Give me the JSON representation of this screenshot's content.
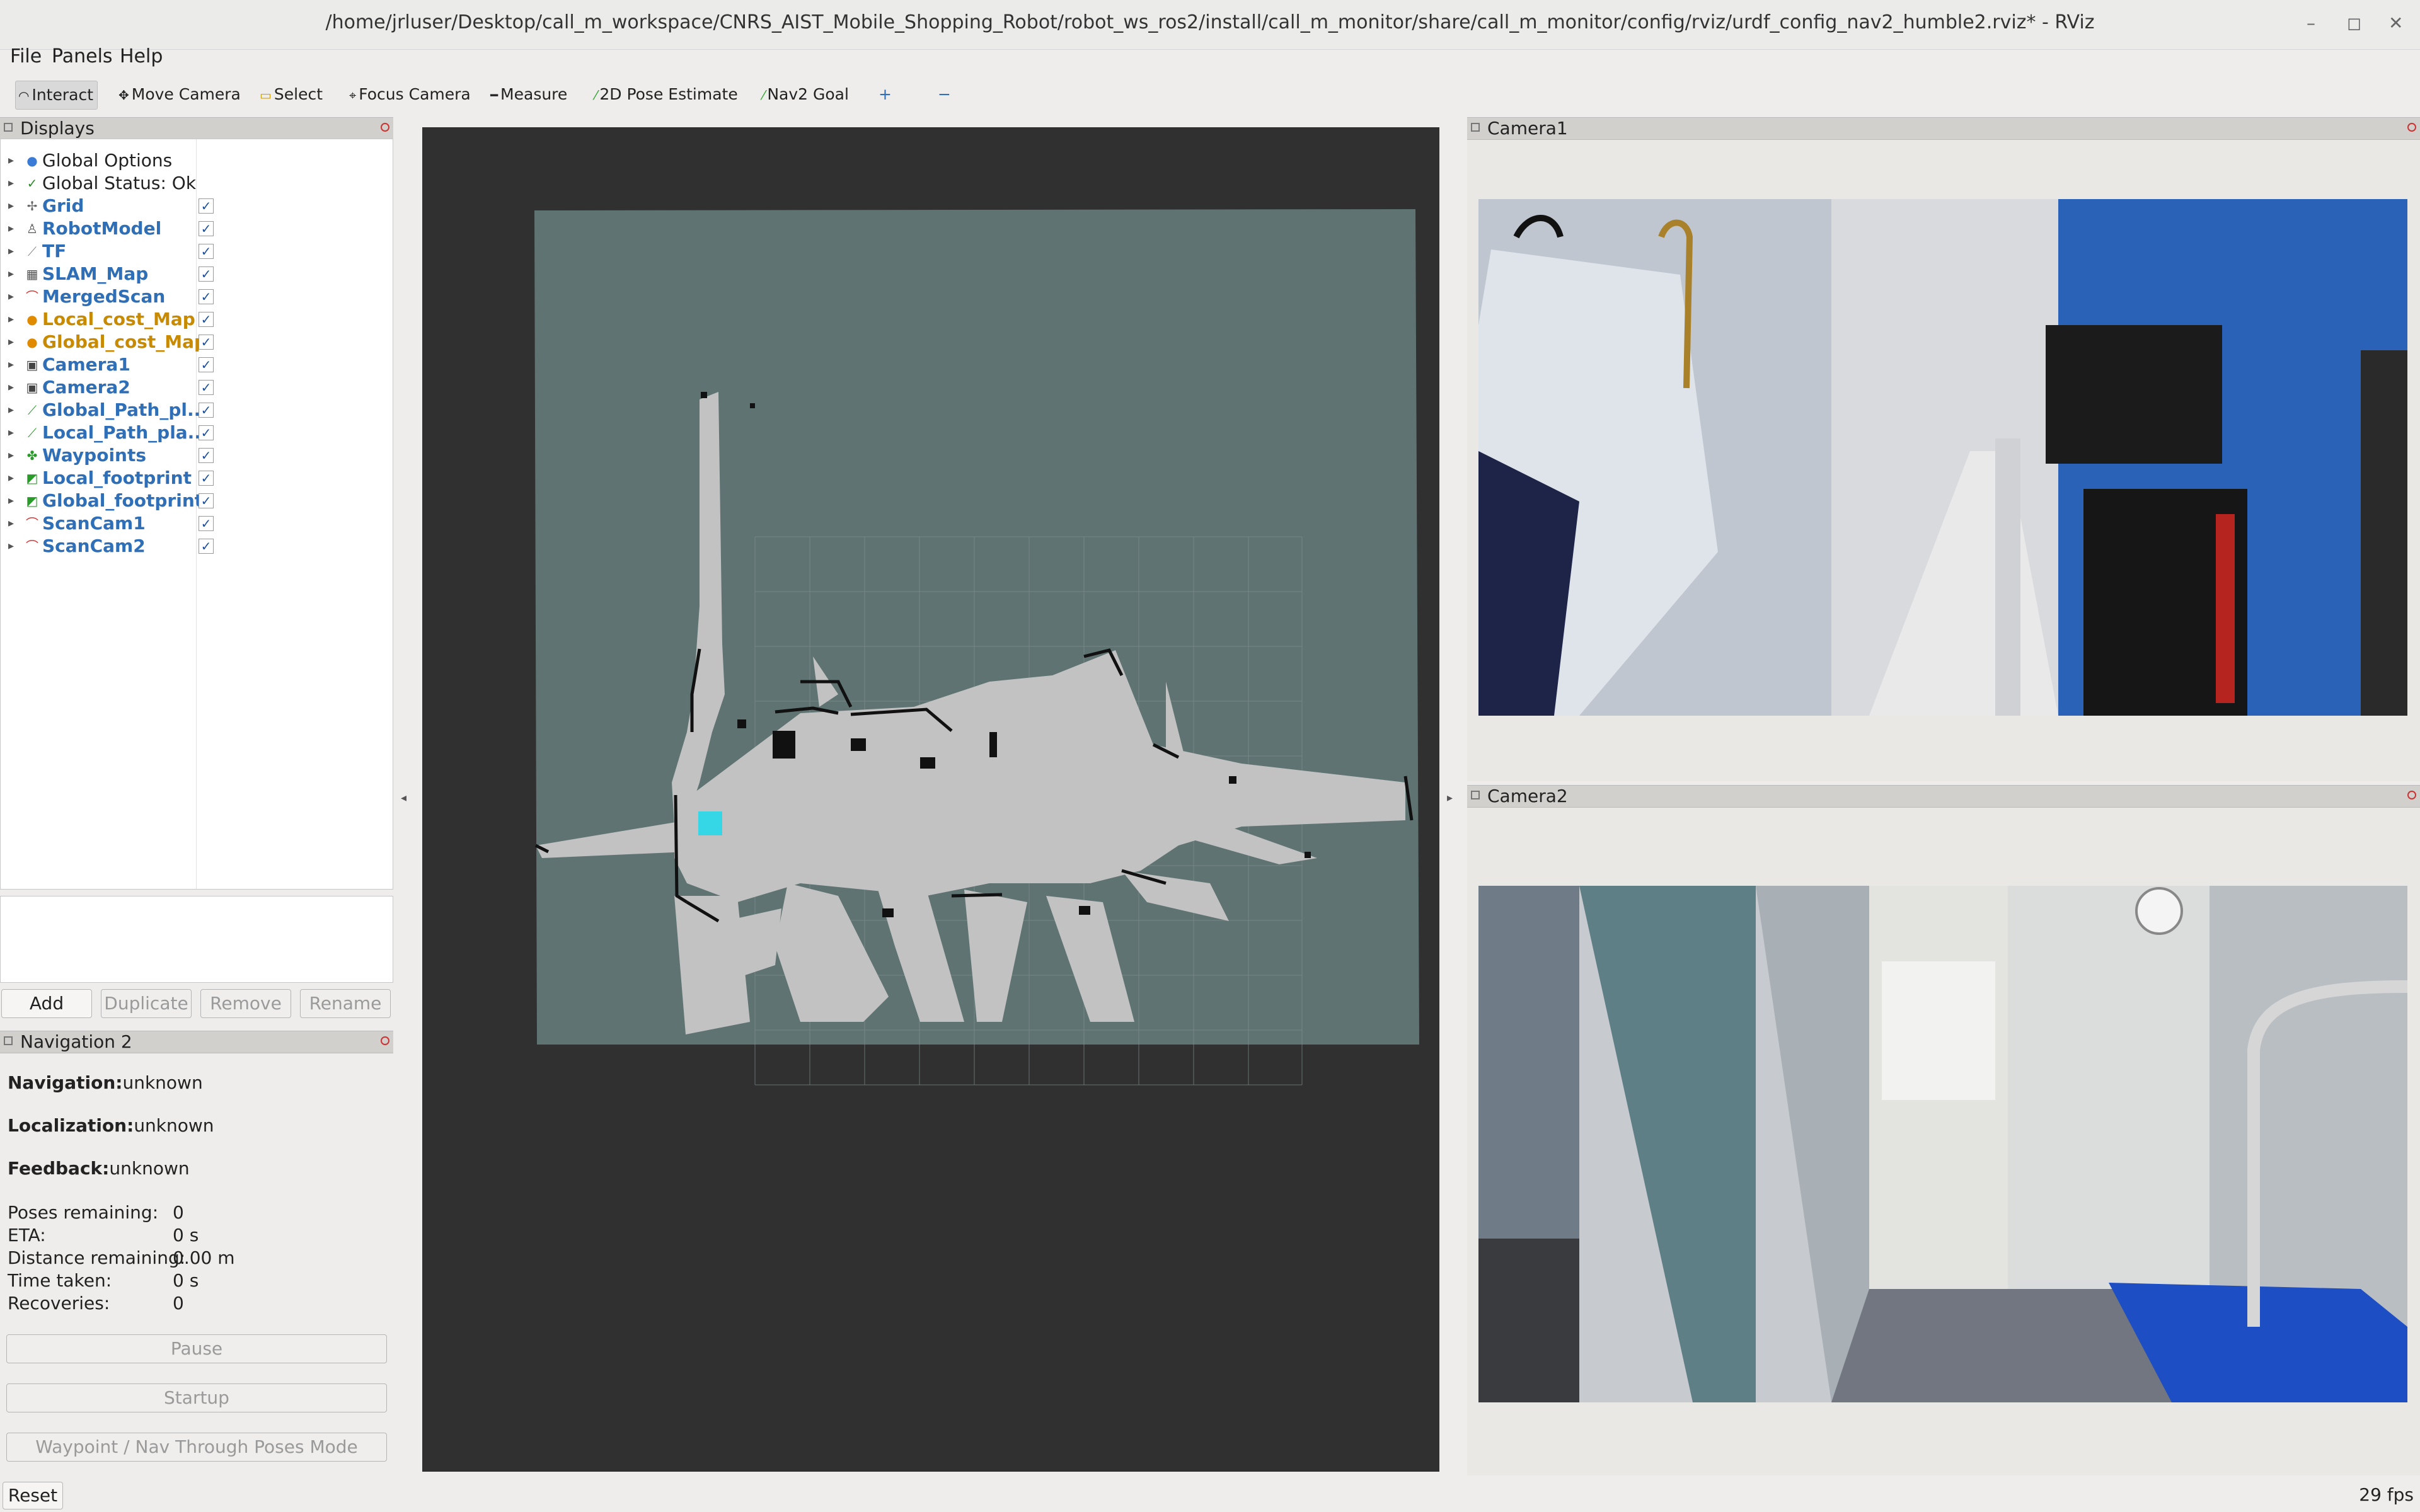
{
  "window": {
    "title": "/home/jrluser/Desktop/call_m_workspace/CNRS_AIST_Mobile_Shopping_Robot/robot_ws_ros2/install/call_m_monitor/share/call_m_monitor/config/rviz/urdf_config_nav2_humble2.rviz* - RViz",
    "minimize": "–",
    "maximize": "◻",
    "close": "✕"
  },
  "menu": {
    "file": "File",
    "panels": "Panels",
    "help": "Help"
  },
  "toolbar": {
    "interact": "Interact",
    "move_camera": "Move Camera",
    "select": "Select",
    "focus_camera": "Focus Camera",
    "measure": "Measure",
    "pose_estimate": "2D Pose Estimate",
    "nav2_goal": "Nav2 Goal",
    "plus": "+",
    "minus": "−"
  },
  "displays": {
    "title": "Displays",
    "items": [
      {
        "label": "Global Options",
        "icon": "gear-icon",
        "style": "plain",
        "checked": null
      },
      {
        "label": "Global Status: Ok",
        "icon": "check-icon",
        "style": "plain",
        "checked": null
      },
      {
        "label": "Grid",
        "icon": "grid-icon",
        "style": "blue",
        "checked": true
      },
      {
        "label": "RobotModel",
        "icon": "robot-icon",
        "style": "blue",
        "checked": true
      },
      {
        "label": "TF",
        "icon": "axes-icon",
        "style": "blue",
        "checked": true
      },
      {
        "label": "SLAM_Map",
        "icon": "map-icon",
        "style": "blue",
        "checked": true
      },
      {
        "label": "MergedScan",
        "icon": "laserscan-icon",
        "style": "blue",
        "checked": true
      },
      {
        "label": "Local_cost_Map",
        "icon": "warning-icon",
        "style": "orange",
        "checked": true
      },
      {
        "label": "Global_cost_Map",
        "icon": "warning-icon",
        "style": "orange",
        "checked": true
      },
      {
        "label": "Camera1",
        "icon": "camera-icon",
        "style": "blue",
        "checked": true
      },
      {
        "label": "Camera2",
        "icon": "camera-icon",
        "style": "blue",
        "checked": true
      },
      {
        "label": "Global_Path_pl...",
        "icon": "path-icon",
        "style": "blue",
        "checked": true
      },
      {
        "label": "Local_Path_pla...",
        "icon": "path-icon",
        "style": "blue",
        "checked": true
      },
      {
        "label": "Waypoints",
        "icon": "markers-icon",
        "style": "blue",
        "checked": true
      },
      {
        "label": "Local_footprint",
        "icon": "polygon-icon",
        "style": "blue",
        "checked": true
      },
      {
        "label": "Global_footprint",
        "icon": "polygon-icon",
        "style": "blue",
        "checked": true
      },
      {
        "label": "ScanCam1",
        "icon": "laserscan-icon",
        "style": "blue",
        "checked": true
      },
      {
        "label": "ScanCam2",
        "icon": "laserscan-icon",
        "style": "blue",
        "checked": true
      }
    ],
    "buttons": {
      "add": "Add",
      "duplicate": "Duplicate",
      "remove": "Remove",
      "rename": "Rename"
    },
    "check_glyph": "✓"
  },
  "nav2": {
    "title": "Navigation 2",
    "navigation_label": "Navigation:",
    "navigation_value": "unknown",
    "localization_label": "Localization:",
    "localization_value": "unknown",
    "feedback_label": "Feedback:",
    "feedback_value": "unknown",
    "stats": [
      {
        "key": "Poses remaining:",
        "value": "0"
      },
      {
        "key": "ETA:",
        "value": "0 s"
      },
      {
        "key": "Distance remaining:",
        "value": "0.00 m"
      },
      {
        "key": "Time taken:",
        "value": "0 s"
      },
      {
        "key": "Recoveries:",
        "value": "0"
      }
    ],
    "pause": "Pause",
    "startup": "Startup",
    "mode": "Waypoint / Nav Through Poses Mode"
  },
  "camera1": {
    "title": "Camera1"
  },
  "camera2": {
    "title": "Camera2"
  },
  "status": {
    "reset": "Reset",
    "fps": "29 fps"
  },
  "colors": {
    "map_unknown": "#5f7472",
    "map_free": "#c2c2c2",
    "map_wall": "#111111",
    "viewport_bg": "#303030",
    "robot": "#35d6e6"
  }
}
